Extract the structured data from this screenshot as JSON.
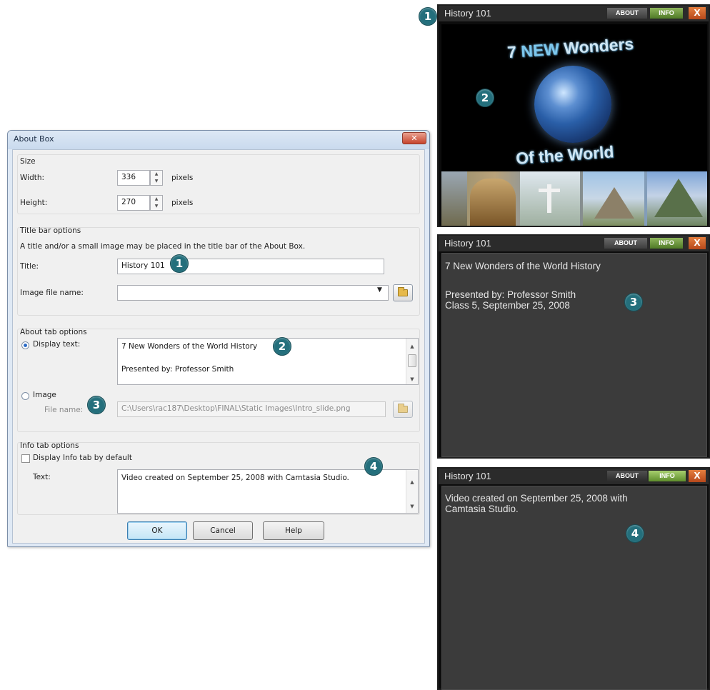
{
  "dialog": {
    "title": "About Box",
    "size": {
      "group_label": "Size",
      "width_label": "Width:",
      "width_value": "336",
      "height_label": "Height:",
      "height_value": "270",
      "unit": "pixels"
    },
    "title_bar": {
      "group_label": "Title bar options",
      "description": "A title and/or a small image may be placed in the title bar of the About Box.",
      "title_label": "Title:",
      "title_value": "History 101",
      "image_label": "Image file name:",
      "image_value": ""
    },
    "about_tab": {
      "group_label": "About tab options",
      "display_text_label": "Display text:",
      "display_text_line1": "7 New Wonders of the World History",
      "display_text_line2": "Presented by: Professor Smith",
      "image_label": "Image",
      "file_name_label": "File name:",
      "file_name_value": "C:\\Users\\rac187\\Desktop\\FINAL\\Static Images\\Intro_slide.png",
      "selected": "Display text"
    },
    "info_tab": {
      "group_label": "Info tab options",
      "default_checkbox_label": "Display Info tab by default",
      "default_checked": false,
      "text_label": "Text:",
      "text_value": "Video created on September 25, 2008 with Camtasia Studio."
    },
    "buttons": {
      "ok": "OK",
      "cancel": "Cancel",
      "help": "Help"
    }
  },
  "callouts": {
    "one": "1",
    "two": "2",
    "three": "3",
    "four": "4"
  },
  "players": {
    "title": "History 101",
    "about_tab": "ABOUT",
    "info_tab": "INFO",
    "close": "X",
    "slide": {
      "number_word": "7",
      "new_word": "NEW",
      "wonders_word": "Wonders",
      "line2": "Of the World"
    },
    "about_pane": {
      "line1": "7 New Wonders of the World History",
      "line2": "Presented by: Professor Smith",
      "line3": "Class 5, September 25, 2008"
    },
    "info_pane": {
      "line1": "Video created on September 25, 2008 with",
      "line2": "Camtasia Studio."
    }
  },
  "colors": {
    "callout": "#246f7c",
    "info_tab": "#6a9a3a",
    "close": "#d0602a",
    "player_background": "#3b3b3b"
  }
}
